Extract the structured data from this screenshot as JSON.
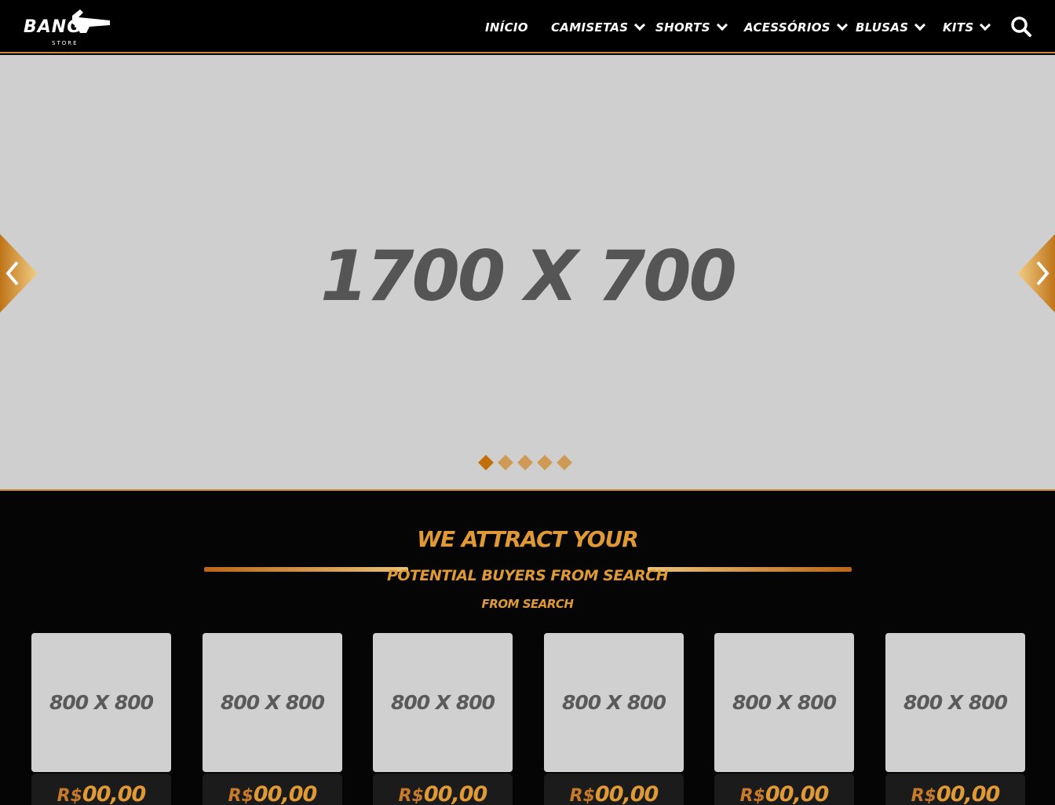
{
  "logo": {
    "text": "BANG",
    "subtext": "STORE"
  },
  "nav": {
    "items": [
      {
        "label": "INÍCIO",
        "has_dropdown": false
      },
      {
        "label": "CAMISETAS",
        "has_dropdown": true
      },
      {
        "label": "SHORTS",
        "has_dropdown": true
      },
      {
        "label": "ACESSÓRIOS",
        "has_dropdown": true
      },
      {
        "label": "BLUSAS",
        "has_dropdown": true
      },
      {
        "label": "KITS",
        "has_dropdown": true
      }
    ],
    "search_icon": "search-icon"
  },
  "hero": {
    "placeholder": "1700 X 700",
    "prev_icon": "chevron-left-icon",
    "next_icon": "chevron-right-icon",
    "slide_count": 5,
    "active_slide": 1
  },
  "section": {
    "title": "WE ATTRACT YOUR",
    "subtitle": "POTENTIAL BUYERS FROM SEARCH",
    "subtitle2": "FROM SEARCH"
  },
  "products": [
    {
      "image": "800 X 800",
      "currency": "R$",
      "price": "00,00"
    },
    {
      "image": "800 X 800",
      "currency": "R$",
      "price": "00,00"
    },
    {
      "image": "800 X 800",
      "currency": "R$",
      "price": "00,00"
    },
    {
      "image": "800 X 800",
      "currency": "R$",
      "price": "00,00"
    },
    {
      "image": "800 X 800",
      "currency": "R$",
      "price": "00,00"
    },
    {
      "image": "800 X 800",
      "currency": "R$",
      "price": "00,00"
    }
  ],
  "colors": {
    "accent": "#e09a35",
    "accent_dark": "#c06f0a",
    "background": "#050505",
    "placeholder": "#cfcfcf"
  }
}
